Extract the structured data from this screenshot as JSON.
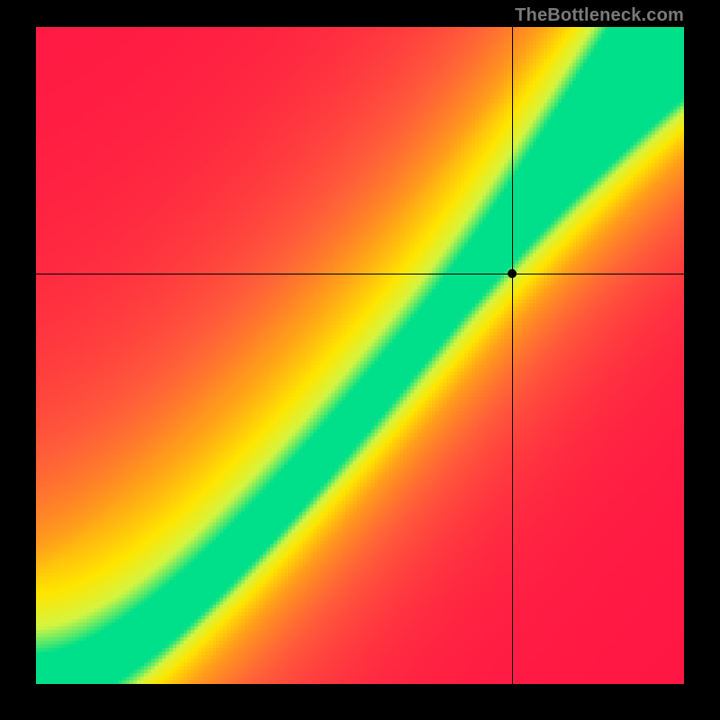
{
  "watermark": "TheBottleneck.com",
  "chart_data": {
    "type": "heatmap",
    "title": "",
    "xlabel": "",
    "ylabel": "",
    "xlim": [
      0,
      1
    ],
    "ylim": [
      0,
      1
    ],
    "grid": false,
    "legend": false,
    "marker": {
      "x": 0.735,
      "y": 0.625
    },
    "crosshair": {
      "x": 0.735,
      "y": 0.625
    },
    "ridge": {
      "description": "Green optimal band roughly along y ≈ x^1.35 with slight S-curve; value falls off with distance from ridge.",
      "exponent_low": 1.6,
      "exponent_high": 1.1,
      "band_halfwidth": 0.045
    },
    "colorscale": [
      {
        "t": 0.0,
        "hex": "#ff1744"
      },
      {
        "t": 0.3,
        "hex": "#ff5e3a"
      },
      {
        "t": 0.55,
        "hex": "#ff9f1a"
      },
      {
        "t": 0.75,
        "hex": "#ffe600"
      },
      {
        "t": 0.88,
        "hex": "#d4f542"
      },
      {
        "t": 1.0,
        "hex": "#00e08a"
      }
    ],
    "resolution": {
      "w": 180,
      "h": 183
    }
  }
}
